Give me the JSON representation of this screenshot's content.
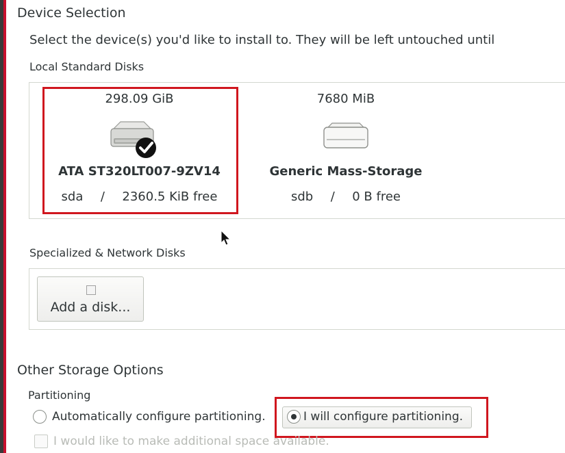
{
  "device_selection": {
    "title": "Device Selection",
    "description": "Select the device(s) you'd like to install to.  They will be left untouched until"
  },
  "local_disks": {
    "label": "Local Standard Disks",
    "disks": [
      {
        "size": "298.09 GiB",
        "name": "ATA ST320LT007-9ZV14",
        "device": "sda",
        "separator": "/",
        "free": "2360.5 KiB free",
        "selected": true,
        "icon": "hard-drive-icon"
      },
      {
        "size": "7680 MiB",
        "name": "Generic Mass-Storage",
        "device": "sdb",
        "separator": "/",
        "free": "0 B free",
        "selected": false,
        "icon": "usb-drive-icon"
      }
    ]
  },
  "network_disks": {
    "label": "Specialized & Network Disks",
    "add_button": "Add a disk..."
  },
  "other_storage": {
    "title": "Other Storage Options",
    "partitioning_label": "Partitioning",
    "options": [
      {
        "label": "Automatically configure partitioning.",
        "checked": false
      },
      {
        "label": "I will configure partitioning.",
        "checked": true
      }
    ],
    "additional_space": "I would like to make additional space available."
  },
  "colors": {
    "highlight": "#d0161e",
    "text": "#2e3436",
    "disabled_text": "#b8bbb6"
  }
}
